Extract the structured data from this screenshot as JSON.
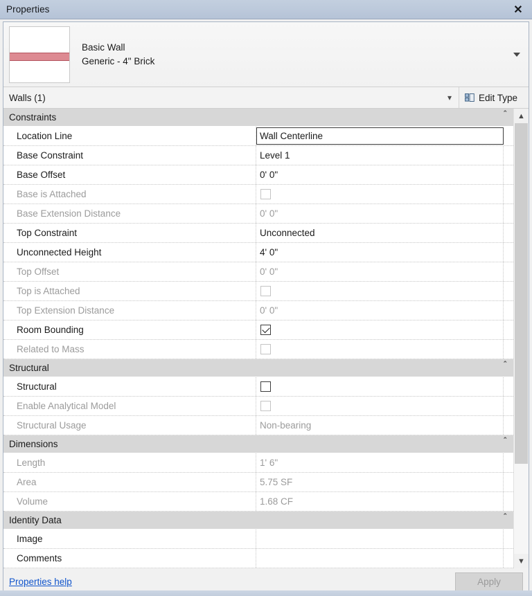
{
  "window": {
    "title": "Properties",
    "close_label": "✕"
  },
  "preview": {
    "family": "Basic Wall",
    "type_name": "Generic - 4\" Brick",
    "dropdown_icon": "triangle-down-icon"
  },
  "selector": {
    "value": "Walls (1)",
    "chevron_icon": "chevron-down-icon",
    "edit_type_label": "Edit Type",
    "edit_type_icon": "edit-type-grid-icon"
  },
  "scrollbar": {
    "up_icon": "chevron-up-icon",
    "down_icon": "chevron-down-icon"
  },
  "footer": {
    "help_label": "Properties help",
    "apply_label": "Apply"
  },
  "collapse_glyph": "⌃",
  "sections": [
    {
      "name": "Constraints",
      "rows": [
        {
          "label": "Location Line",
          "value": "Wall Centerline",
          "kind": "text",
          "enabled": true,
          "focused": true
        },
        {
          "label": "Base Constraint",
          "value": "Level 1",
          "kind": "text",
          "enabled": true,
          "focused": false
        },
        {
          "label": "Base Offset",
          "value": "0'  0\"",
          "kind": "text",
          "enabled": true,
          "focused": false
        },
        {
          "label": "Base is Attached",
          "value": "",
          "kind": "checkbox",
          "checked": false,
          "enabled": false,
          "focused": false
        },
        {
          "label": "Base Extension Distance",
          "value": "0'  0\"",
          "kind": "text",
          "enabled": false,
          "focused": false
        },
        {
          "label": "Top Constraint",
          "value": "Unconnected",
          "kind": "text",
          "enabled": true,
          "focused": false
        },
        {
          "label": "Unconnected Height",
          "value": "4'  0\"",
          "kind": "text",
          "enabled": true,
          "focused": false
        },
        {
          "label": "Top Offset",
          "value": "0'  0\"",
          "kind": "text",
          "enabled": false,
          "focused": false
        },
        {
          "label": "Top is Attached",
          "value": "",
          "kind": "checkbox",
          "checked": false,
          "enabled": false,
          "focused": false
        },
        {
          "label": "Top Extension Distance",
          "value": "0'  0\"",
          "kind": "text",
          "enabled": false,
          "focused": false
        },
        {
          "label": "Room Bounding",
          "value": "",
          "kind": "checkbox",
          "checked": true,
          "enabled": true,
          "focused": false
        },
        {
          "label": "Related to Mass",
          "value": "",
          "kind": "checkbox",
          "checked": false,
          "enabled": false,
          "focused": false
        }
      ]
    },
    {
      "name": "Structural",
      "rows": [
        {
          "label": "Structural",
          "value": "",
          "kind": "checkbox",
          "checked": false,
          "enabled": true,
          "focused": false
        },
        {
          "label": "Enable Analytical Model",
          "value": "",
          "kind": "checkbox",
          "checked": false,
          "enabled": false,
          "focused": false
        },
        {
          "label": "Structural Usage",
          "value": "Non-bearing",
          "kind": "text",
          "enabled": false,
          "focused": false
        }
      ]
    },
    {
      "name": "Dimensions",
      "rows": [
        {
          "label": "Length",
          "value": "1'  6\"",
          "kind": "text",
          "enabled": false,
          "focused": false
        },
        {
          "label": "Area",
          "value": "5.75 SF",
          "kind": "text",
          "enabled": false,
          "focused": false
        },
        {
          "label": "Volume",
          "value": "1.68 CF",
          "kind": "text",
          "enabled": false,
          "focused": false
        }
      ]
    },
    {
      "name": "Identity Data",
      "rows": [
        {
          "label": "Image",
          "value": "",
          "kind": "text",
          "enabled": true,
          "focused": false
        },
        {
          "label": "Comments",
          "value": "",
          "kind": "text",
          "enabled": true,
          "focused": false
        }
      ]
    }
  ]
}
